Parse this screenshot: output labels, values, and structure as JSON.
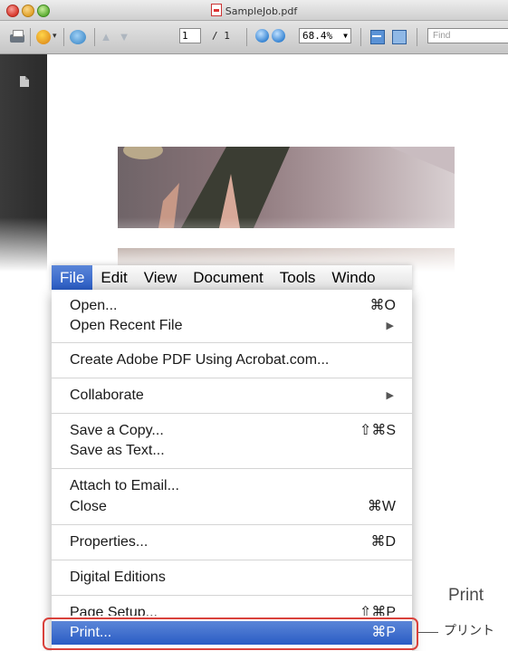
{
  "window": {
    "title": "SampleJob.pdf"
  },
  "toolbar": {
    "page_current": "1",
    "page_total": "/ 1",
    "zoom": "68.4%",
    "find_placeholder": "Find",
    "icons": [
      "print-icon",
      "create-pdf-icon",
      "collaborate-icon",
      "share-icon",
      "previous-page-icon",
      "next-page-icon",
      "zoom-out-icon",
      "zoom-in-icon",
      "fit-width-icon",
      "fit-page-icon"
    ]
  },
  "menubar": {
    "items": [
      "File",
      "Edit",
      "View",
      "Document",
      "Tools",
      "Windo"
    ],
    "active": "File"
  },
  "file_menu": {
    "open": {
      "label": "Open...",
      "shortcut": "⌘O"
    },
    "open_recent": {
      "label": "Open Recent File",
      "arrow": "▶"
    },
    "create_pdf": {
      "label": "Create Adobe PDF Using Acrobat.com..."
    },
    "collaborate": {
      "label": "Collaborate",
      "arrow": "▶"
    },
    "save_copy": {
      "label": "Save a Copy...",
      "shortcut": "⇧⌘S"
    },
    "save_text": {
      "label": "Save as Text..."
    },
    "attach_email": {
      "label": "Attach to Email..."
    },
    "close": {
      "label": "Close",
      "shortcut": "⌘W"
    },
    "properties": {
      "label": "Properties...",
      "shortcut": "⌘D"
    },
    "digital_editions": {
      "label": "Digital Editions"
    },
    "page_setup": {
      "label": "Page Setup...",
      "shortcut": "⇧⌘P"
    },
    "print": {
      "label": "Print...",
      "shortcut": "⌘P"
    }
  },
  "annotation": {
    "english": "Print",
    "japanese": "プリント"
  },
  "colors": {
    "highlight": "#2a5cc4",
    "callout": "#d9413b",
    "sidepanel": "#2b2b2b"
  }
}
